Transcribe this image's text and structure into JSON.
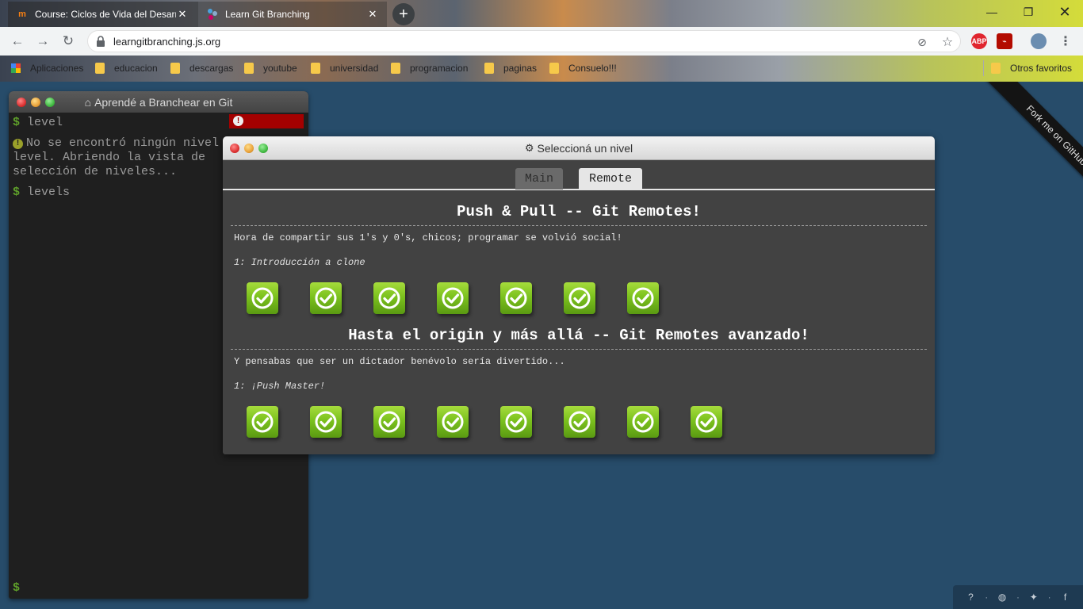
{
  "browser": {
    "tabs": [
      {
        "label": "Course: Ciclos de Vida del Desarrollo",
        "active": true
      },
      {
        "label": "Learn Git Branching",
        "active": false
      }
    ],
    "url": "learngitbranching.js.org",
    "extensions": {
      "abp": "ABP"
    },
    "bookmarks": {
      "apps": "Aplicaciones",
      "items": [
        "educacion",
        "descargas",
        "youtube",
        "universidad",
        "programacion",
        "paginas",
        "Consuelo!!!"
      ],
      "other": "Otros favoritos"
    }
  },
  "terminal": {
    "title": "Aprendé a Branchear en Git",
    "lines": {
      "cmd1": "level",
      "msg": "No se encontró ningún nivel level. Abriendo la vista de selección de niveles...",
      "cmd2": "levels"
    },
    "prompt_symbol": "$"
  },
  "ribbon": "Fork me on GitHub",
  "dialog": {
    "title": "Seleccioná un nivel",
    "tabs": {
      "main": "Main",
      "remote": "Remote"
    },
    "sections": [
      {
        "title": "Push & Pull -- Git Remotes!",
        "about": "Hora de compartir sus 1's y 0's, chicos; programar se volvió social!",
        "current": "1: Introducción a clone",
        "levels_completed": 7
      },
      {
        "title": "Hasta el origin y más allá -- Git Remotes avanzado!",
        "about": "Y pensabas que ser un dictador benévolo sería divertido...",
        "current": "1: ¡Push Master!",
        "levels_completed": 8
      }
    ]
  },
  "colors": {
    "page_bg": "#274c6a",
    "level_green": "#7cc21e",
    "prompt_green": "#5fa02a",
    "error_red": "#a40000"
  }
}
